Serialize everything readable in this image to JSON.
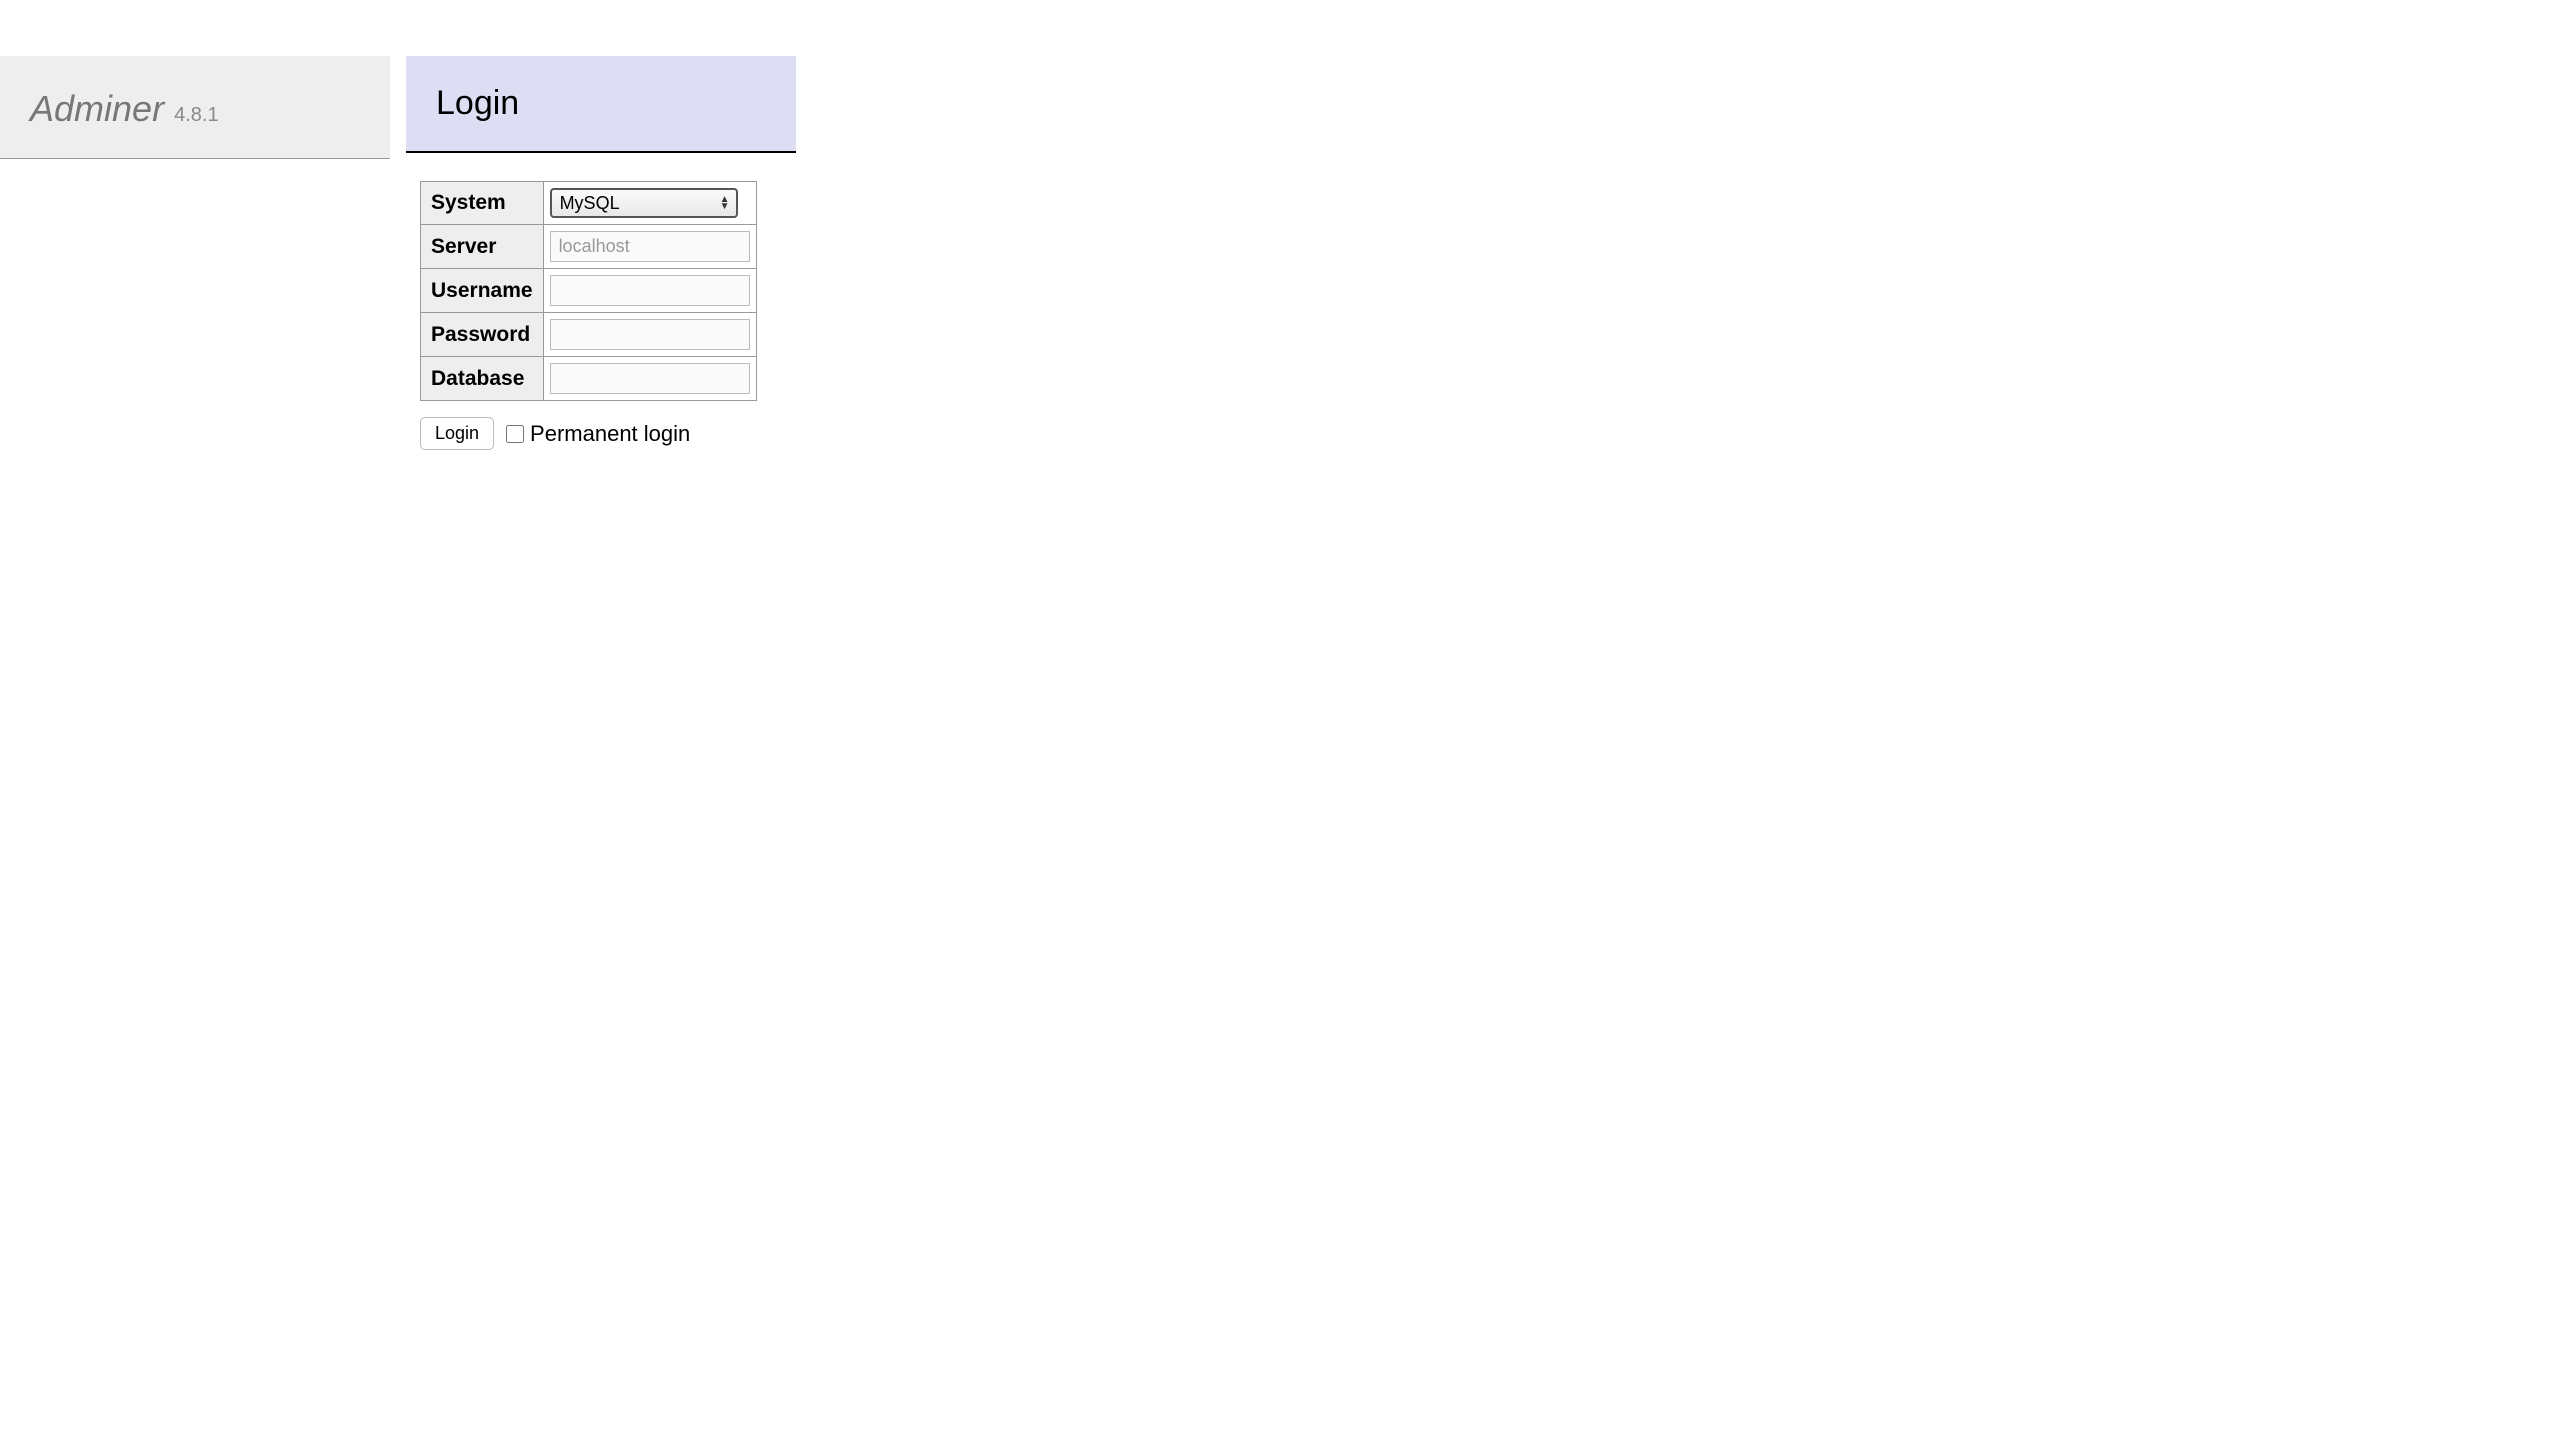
{
  "sidebar": {
    "app_name": "Adminer",
    "version": "4.8.1"
  },
  "header": {
    "title": "Login"
  },
  "form": {
    "labels": {
      "system": "System",
      "server": "Server",
      "username": "Username",
      "password": "Password",
      "database": "Database"
    },
    "system": {
      "selected": "MySQL",
      "options": [
        "MySQL"
      ]
    },
    "server": {
      "placeholder": "localhost",
      "value": ""
    },
    "username": {
      "value": ""
    },
    "password": {
      "value": ""
    },
    "database": {
      "value": ""
    },
    "actions": {
      "submit_label": "Login",
      "permanent_label": "Permanent login",
      "permanent_checked": false
    }
  }
}
